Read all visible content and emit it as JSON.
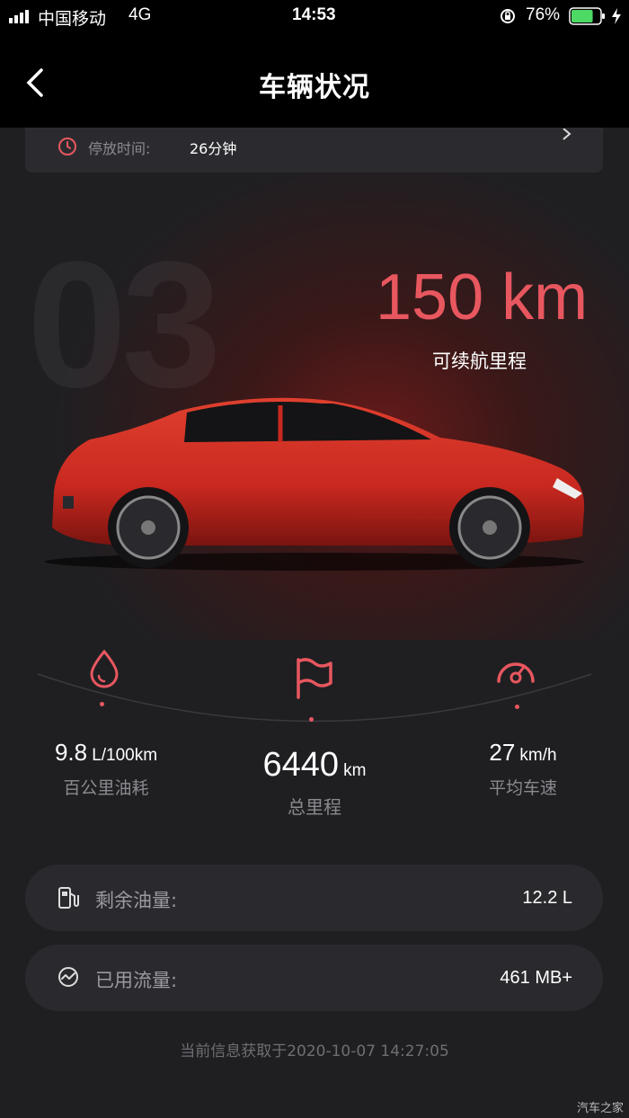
{
  "status_bar": {
    "carrier": "中国移动",
    "network": "4G",
    "time": "14:53",
    "battery": "76%",
    "battery_level": 0.76
  },
  "header": {
    "title": "车辆状况"
  },
  "parking": {
    "label": "停放时间:",
    "value": "26分钟"
  },
  "hero": {
    "range_value": "150 km",
    "range_label": "可续航里程",
    "watermark": "03",
    "car_color": "#c8281f"
  },
  "stats": {
    "fuel_consumption": {
      "value": "9.8",
      "unit": "L/100km",
      "label": "百公里油耗"
    },
    "total_mileage": {
      "value": "6440",
      "unit": "km",
      "label": "总里程"
    },
    "avg_speed": {
      "value": "27",
      "unit": "km/h",
      "label": "平均车速"
    }
  },
  "cards": {
    "fuel": {
      "label": "剩余油量:",
      "value": "12.2 L"
    },
    "data": {
      "label": "已用流量:",
      "value": "461 MB+"
    }
  },
  "footer": {
    "timestamp": "当前信息获取于2020-10-07 14:27:05",
    "watermark": "汽车之家"
  },
  "colors": {
    "accent": "#e8575f",
    "battery": "#4cd964"
  }
}
